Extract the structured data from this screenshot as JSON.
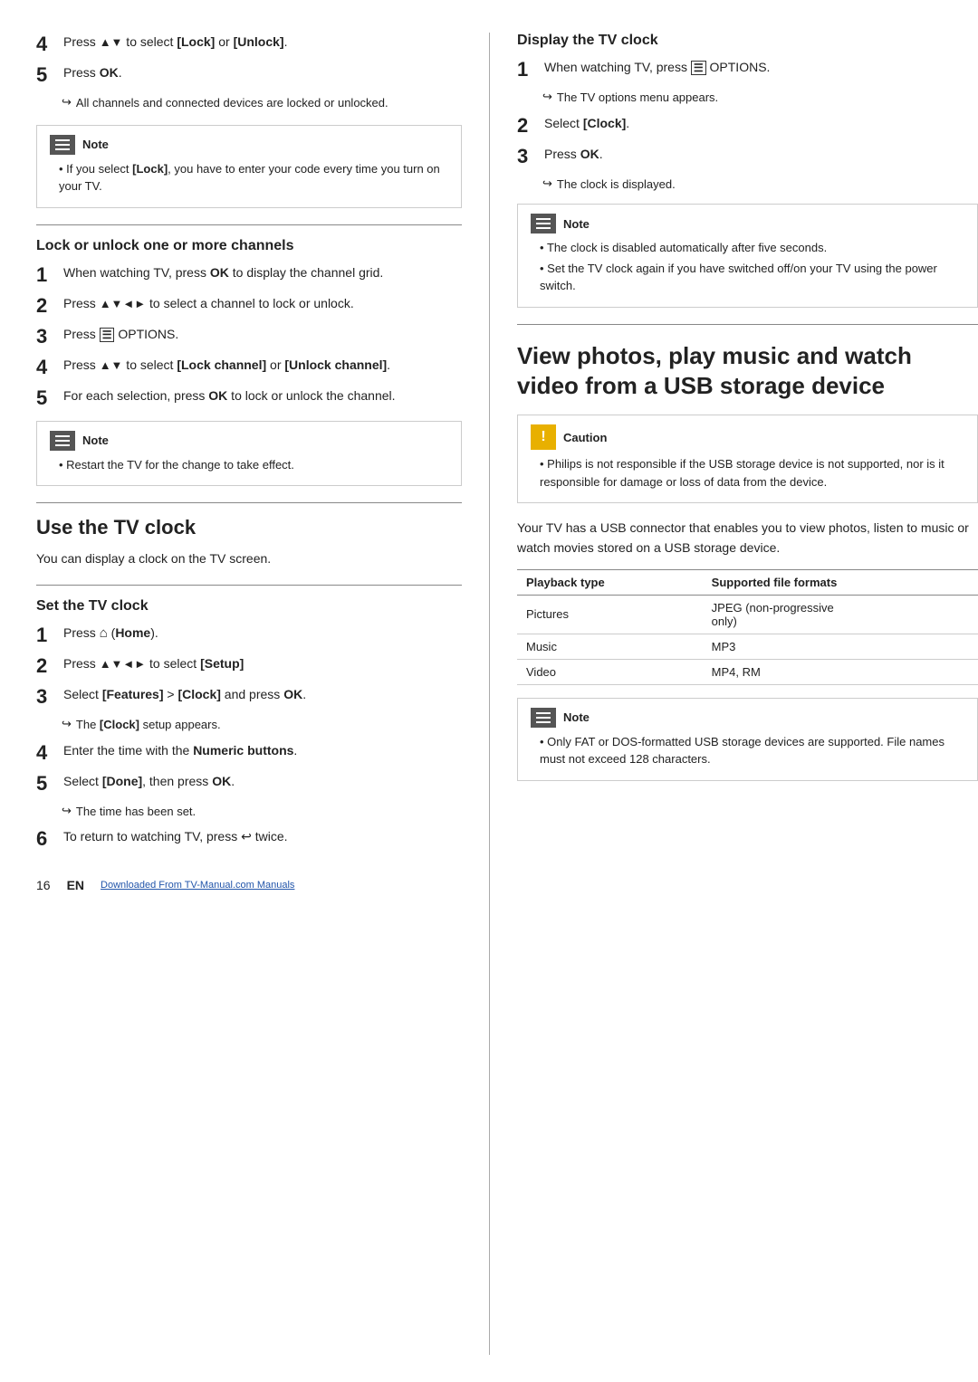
{
  "page": {
    "number": "16",
    "lang": "EN",
    "footer_link": "Downloaded From TV-Manual.com Manuals"
  },
  "left": {
    "top_steps": [
      {
        "num": "4",
        "text": "Press ▲▼ to select [Lock] or [Unlock]."
      },
      {
        "num": "5",
        "text": "Press OK.",
        "result": "All channels and connected devices are locked or unlocked."
      }
    ],
    "top_note": {
      "label": "Note",
      "bullets": [
        "If you select [Lock], you have to enter your code every time you turn on your TV."
      ]
    },
    "lock_section": {
      "title": "Lock or unlock one or more channels",
      "steps": [
        {
          "num": "1",
          "text": "When watching TV, press OK to display the channel grid."
        },
        {
          "num": "2",
          "text": "Press ▲▼◄► to select a channel to lock or unlock."
        },
        {
          "num": "3",
          "text": "Press  OPTIONS."
        },
        {
          "num": "4",
          "text": "Press ▲▼ to select [Lock channel] or [Unlock channel]."
        },
        {
          "num": "5",
          "text": "For each selection, press OK to lock or unlock the channel."
        }
      ],
      "note": {
        "label": "Note",
        "bullets": [
          "Restart the TV for the change to take effect."
        ]
      }
    },
    "clock_section": {
      "title": "Use the TV clock",
      "intro": "You can display a clock on the TV screen.",
      "set_title": "Set the TV clock",
      "set_steps": [
        {
          "num": "1",
          "text": "Press  (Home)."
        },
        {
          "num": "2",
          "text": "Press ▲▼◄► to select [Setup]"
        },
        {
          "num": "3",
          "text": "Select [Features] > [Clock] and press OK.",
          "result": "The [Clock] setup appears."
        },
        {
          "num": "4",
          "text": "Enter the time with the Numeric buttons."
        },
        {
          "num": "5",
          "text": "Select [Done], then press OK.",
          "result": "The time has been set."
        },
        {
          "num": "6",
          "text": "To return to watching TV, press  twice."
        }
      ]
    }
  },
  "right": {
    "display_section": {
      "title": "Display the TV clock",
      "steps": [
        {
          "num": "1",
          "text": "When watching TV, press  OPTIONS.",
          "result": "The TV options menu appears."
        },
        {
          "num": "2",
          "text": "Select [Clock]."
        },
        {
          "num": "3",
          "text": "Press OK.",
          "result": "The clock is displayed."
        }
      ],
      "note": {
        "label": "Note",
        "bullets": [
          "The clock is disabled automatically after five seconds.",
          "Set the TV clock again if you have switched off/on your TV using the power switch."
        ]
      }
    },
    "usb_section": {
      "title": "View photos, play music and watch video from a USB storage device",
      "caution": {
        "label": "Caution",
        "bullets": [
          "Philips is not responsible if the USB storage device is not supported, nor is it responsible for damage or loss of data from the device."
        ]
      },
      "intro": "Your TV has a USB connector that enables you to view photos, listen to music or watch movies stored on a USB storage device.",
      "table": {
        "headers": [
          "Playback type",
          "Supported file formats"
        ],
        "rows": [
          [
            "Pictures",
            "JPEG (non-progressive only)"
          ],
          [
            "Music",
            "MP3"
          ],
          [
            "Video",
            "MP4, RM"
          ]
        ]
      },
      "note": {
        "label": "Note",
        "bullets": [
          "Only FAT or DOS-formatted USB storage devices are supported. File names must not exceed 128 characters."
        ]
      }
    }
  }
}
